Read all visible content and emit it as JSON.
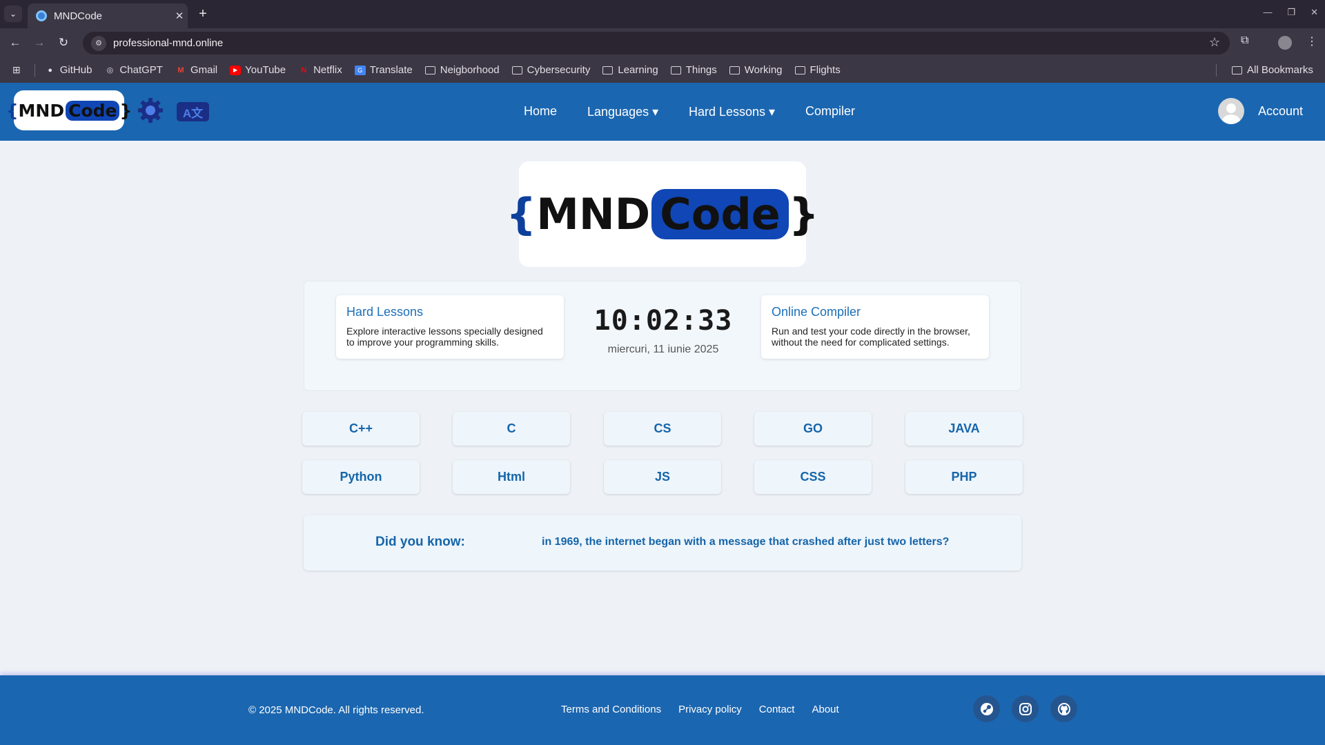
{
  "browser": {
    "tab_title": "MNDCode",
    "url": "professional-mnd.online",
    "bookmarks": [
      {
        "label": "GitHub",
        "icon": "github-icon"
      },
      {
        "label": "ChatGPT",
        "icon": "chatgpt-icon"
      },
      {
        "label": "Gmail",
        "icon": "gmail-icon"
      },
      {
        "label": "YouTube",
        "icon": "youtube-icon"
      },
      {
        "label": "Netflix",
        "icon": "netflix-icon"
      },
      {
        "label": "Translate",
        "icon": "translate-icon"
      },
      {
        "label": "Neigborhood",
        "icon": "folder-icon"
      },
      {
        "label": "Cybersecurity",
        "icon": "folder-icon"
      },
      {
        "label": "Learning",
        "icon": "folder-icon"
      },
      {
        "label": "Things",
        "icon": "folder-icon"
      },
      {
        "label": "Working",
        "icon": "folder-icon"
      },
      {
        "label": "Flights",
        "icon": "folder-icon"
      }
    ],
    "all_bookmarks": "All Bookmarks"
  },
  "header": {
    "logo": {
      "brace_open": "{",
      "mnd": "MND",
      "code": "Code",
      "brace_close": "}"
    },
    "lang_toggle": "A文",
    "nav": {
      "home": "Home",
      "languages": "Languages ▾",
      "hard_lessons": "Hard Lessons ▾",
      "compiler": "Compiler"
    },
    "account": "Account"
  },
  "hero": {
    "brace_open": "{",
    "mnd": "MND",
    "code": "Code",
    "brace_close": "}"
  },
  "info": {
    "hard_lessons": {
      "title": "Hard Lessons",
      "desc": "Explore interactive lessons specially designed to improve your programming skills."
    },
    "clock": {
      "time": "10:02:33",
      "date": "miercuri, 11 iunie 2025"
    },
    "compiler": {
      "title": "Online Compiler",
      "desc": "Run and test your code directly in the browser, without the need for complicated settings."
    }
  },
  "languages": [
    "C++",
    "C",
    "CS",
    "GO",
    "JAVA",
    "Python",
    "Html",
    "JS",
    "CSS",
    "PHP"
  ],
  "fact": {
    "label": "Did you know:",
    "text": "in 1969, the internet began with a message that crashed after just two letters?"
  },
  "footer": {
    "copyright": "© 2025 MNDCode. All rights reserved.",
    "links": [
      "Terms and Conditions",
      "Privacy policy",
      "Contact",
      "About"
    ],
    "socials": [
      "steam-icon",
      "instagram-icon",
      "github-icon"
    ]
  },
  "colors": {
    "brand_blue": "#1b66b0",
    "accent_blue": "#1565aa",
    "logo_pill": "#1046b5"
  }
}
